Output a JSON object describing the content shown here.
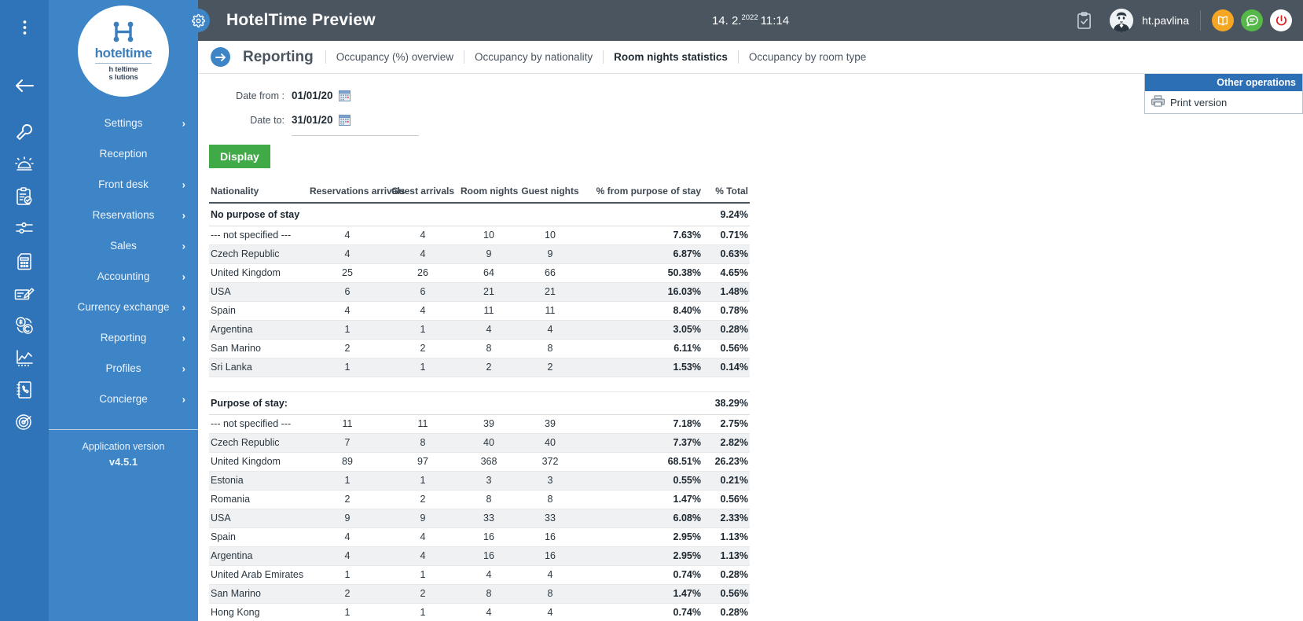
{
  "rail": {
    "icons": [
      {
        "name": "menu-dots-icon"
      },
      {
        "name": "back-arrow-icon"
      },
      {
        "name": "wrench-icon"
      },
      {
        "name": "reception-bell-icon"
      },
      {
        "name": "clipboard-check-icon"
      },
      {
        "name": "sliders-icon"
      },
      {
        "name": "calculator-icon"
      },
      {
        "name": "cheque-pen-icon"
      },
      {
        "name": "currency-exchange-icon"
      },
      {
        "name": "chart-line-icon"
      },
      {
        "name": "phone-book-icon"
      },
      {
        "name": "concierge-target-icon"
      }
    ]
  },
  "sidebar": {
    "logo": {
      "brand": "hoteltime",
      "tagline_line1": "h teltime",
      "tagline_line2": "s lutions"
    },
    "items": [
      {
        "label": "Settings",
        "chevron": "›"
      },
      {
        "label": "Reception",
        "chevron": ""
      },
      {
        "label": "Front desk",
        "chevron": "›"
      },
      {
        "label": "Reservations",
        "chevron": "›"
      },
      {
        "label": "Sales",
        "chevron": "›"
      },
      {
        "label": "Accounting",
        "chevron": "›"
      },
      {
        "label": "Currency exchange",
        "chevron": "›"
      },
      {
        "label": "Reporting",
        "chevron": "›"
      },
      {
        "label": "Profiles",
        "chevron": "›"
      },
      {
        "label": "Concierge",
        "chevron": "›"
      }
    ],
    "version_label": "Application version",
    "version_value": "v4.5.1"
  },
  "topbar": {
    "title": "HotelTime Preview",
    "date_main": "14. 2.",
    "date_year": "2022",
    "time": "11:14",
    "username": "ht.pavlina",
    "icons": {
      "gear": "gear-icon",
      "clipboard": "clipboard-check-icon",
      "avatar": "user-avatar",
      "book": "book-icon",
      "chat": "chat-bubble-icon",
      "power": "power-icon"
    }
  },
  "tabbar": {
    "arrow": "→",
    "section_title": "Reporting",
    "tabs": [
      {
        "label": "Occupancy (%) overview",
        "active": false
      },
      {
        "label": "Occupancy by nationality",
        "active": false
      },
      {
        "label": "Room nights statistics",
        "active": true
      },
      {
        "label": "Occupancy by room type",
        "active": false
      }
    ]
  },
  "filters": {
    "date_from_label": "Date from :",
    "date_from_value": "01/01/20",
    "date_to_label": "Date to:",
    "date_to_value": "31/01/20",
    "calendar_icon": "calendar-icon",
    "display_button": "Display"
  },
  "operations": {
    "title": "Other operations",
    "items": [
      {
        "label": "Print version",
        "icon": "printer-icon"
      }
    ]
  },
  "table": {
    "headers": {
      "nationality": "Nationality",
      "reservations_arrivals": "Reservations arrivals",
      "guest_arrivals": "Guest arrivals",
      "room_nights": "Room nights",
      "guest_nights": "Guest nights",
      "pct_from_purpose": "% from purpose of stay",
      "pct_total": "% Total"
    },
    "sections": [
      {
        "title": "No purpose of stay",
        "section_total": "9.24%",
        "rows": [
          {
            "nationality": "--- not specified ---",
            "reservations_arrivals": "4",
            "guest_arrivals": "4",
            "room_nights": "10",
            "guest_nights": "10",
            "pct_from_purpose": "7.63%",
            "pct_total": "0.71%"
          },
          {
            "nationality": "Czech Republic",
            "reservations_arrivals": "4",
            "guest_arrivals": "4",
            "room_nights": "9",
            "guest_nights": "9",
            "pct_from_purpose": "6.87%",
            "pct_total": "0.63%"
          },
          {
            "nationality": "United Kingdom",
            "reservations_arrivals": "25",
            "guest_arrivals": "26",
            "room_nights": "64",
            "guest_nights": "66",
            "pct_from_purpose": "50.38%",
            "pct_total": "4.65%"
          },
          {
            "nationality": "USA",
            "reservations_arrivals": "6",
            "guest_arrivals": "6",
            "room_nights": "21",
            "guest_nights": "21",
            "pct_from_purpose": "16.03%",
            "pct_total": "1.48%"
          },
          {
            "nationality": "Spain",
            "reservations_arrivals": "4",
            "guest_arrivals": "4",
            "room_nights": "11",
            "guest_nights": "11",
            "pct_from_purpose": "8.40%",
            "pct_total": "0.78%"
          },
          {
            "nationality": "Argentina",
            "reservations_arrivals": "1",
            "guest_arrivals": "1",
            "room_nights": "4",
            "guest_nights": "4",
            "pct_from_purpose": "3.05%",
            "pct_total": "0.28%"
          },
          {
            "nationality": "San Marino",
            "reservations_arrivals": "2",
            "guest_arrivals": "2",
            "room_nights": "8",
            "guest_nights": "8",
            "pct_from_purpose": "6.11%",
            "pct_total": "0.56%"
          },
          {
            "nationality": "Sri Lanka",
            "reservations_arrivals": "1",
            "guest_arrivals": "1",
            "room_nights": "2",
            "guest_nights": "2",
            "pct_from_purpose": "1.53%",
            "pct_total": "0.14%"
          }
        ]
      },
      {
        "title": "Purpose of stay:",
        "section_total": "38.29%",
        "rows": [
          {
            "nationality": "--- not specified ---",
            "reservations_arrivals": "11",
            "guest_arrivals": "11",
            "room_nights": "39",
            "guest_nights": "39",
            "pct_from_purpose": "7.18%",
            "pct_total": "2.75%"
          },
          {
            "nationality": "Czech Republic",
            "reservations_arrivals": "7",
            "guest_arrivals": "8",
            "room_nights": "40",
            "guest_nights": "40",
            "pct_from_purpose": "7.37%",
            "pct_total": "2.82%"
          },
          {
            "nationality": "United Kingdom",
            "reservations_arrivals": "89",
            "guest_arrivals": "97",
            "room_nights": "368",
            "guest_nights": "372",
            "pct_from_purpose": "68.51%",
            "pct_total": "26.23%"
          },
          {
            "nationality": "Estonia",
            "reservations_arrivals": "1",
            "guest_arrivals": "1",
            "room_nights": "3",
            "guest_nights": "3",
            "pct_from_purpose": "0.55%",
            "pct_total": "0.21%"
          },
          {
            "nationality": "Romania",
            "reservations_arrivals": "2",
            "guest_arrivals": "2",
            "room_nights": "8",
            "guest_nights": "8",
            "pct_from_purpose": "1.47%",
            "pct_total": "0.56%"
          },
          {
            "nationality": "USA",
            "reservations_arrivals": "9",
            "guest_arrivals": "9",
            "room_nights": "33",
            "guest_nights": "33",
            "pct_from_purpose": "6.08%",
            "pct_total": "2.33%"
          },
          {
            "nationality": "Spain",
            "reservations_arrivals": "4",
            "guest_arrivals": "4",
            "room_nights": "16",
            "guest_nights": "16",
            "pct_from_purpose": "2.95%",
            "pct_total": "1.13%"
          },
          {
            "nationality": "Argentina",
            "reservations_arrivals": "4",
            "guest_arrivals": "4",
            "room_nights": "16",
            "guest_nights": "16",
            "pct_from_purpose": "2.95%",
            "pct_total": "1.13%"
          },
          {
            "nationality": "United Arab Emirates",
            "reservations_arrivals": "1",
            "guest_arrivals": "1",
            "room_nights": "4",
            "guest_nights": "4",
            "pct_from_purpose": "0.74%",
            "pct_total": "0.28%"
          },
          {
            "nationality": "San Marino",
            "reservations_arrivals": "2",
            "guest_arrivals": "2",
            "room_nights": "8",
            "guest_nights": "8",
            "pct_from_purpose": "1.47%",
            "pct_total": "0.56%"
          },
          {
            "nationality": "Hong Kong",
            "reservations_arrivals": "1",
            "guest_arrivals": "1",
            "room_nights": "4",
            "guest_nights": "4",
            "pct_from_purpose": "0.74%",
            "pct_total": "0.28%"
          }
        ]
      }
    ]
  },
  "colors": {
    "sidebar": "#3d85c6",
    "rail": "#2f73b8",
    "topbar": "#4a5560",
    "accent_blue": "#2d6fb5",
    "green_button": "#3faa46",
    "orange": "#f5a623",
    "green": "#55b848",
    "red": "#e02020"
  }
}
